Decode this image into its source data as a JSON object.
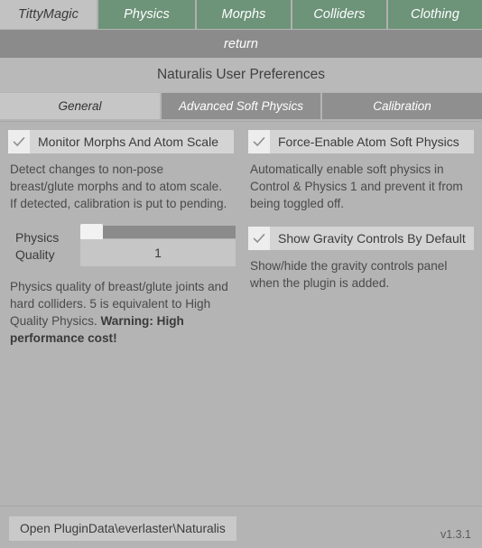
{
  "window": {
    "background_color": "#b4b4b4",
    "accent_green": "#6d9379"
  },
  "plugin_tabs": {
    "items": [
      {
        "label": "TittyMagic",
        "active": true
      },
      {
        "label": "Physics",
        "active": false
      },
      {
        "label": "Morphs",
        "active": false
      },
      {
        "label": "Colliders",
        "active": false
      },
      {
        "label": "Clothing",
        "active": false
      }
    ]
  },
  "return_bar": {
    "label": "return"
  },
  "header": {
    "title": "Naturalis User Preferences"
  },
  "sub_tabs": {
    "items": [
      {
        "label": "General",
        "active": true
      },
      {
        "label": "Advanced Soft Physics",
        "active": false
      },
      {
        "label": "Calibration",
        "active": false
      }
    ]
  },
  "left_column": {
    "monitor_morphs": {
      "label": "Monitor Morphs And Atom Scale",
      "checked": true,
      "check_icon": "check-icon",
      "description": "Detect changes to non-pose\nbreast/glute morphs and to atom scale.\nIf detected, calibration is put to pending."
    },
    "physics_quality": {
      "label": "Physics\nQuality",
      "value": "1",
      "handle_position_percent": 0,
      "description_part1": "Physics quality of breast/glute joints and hard colliders. 5 is equivalent to High Quality Physics. ",
      "description_warning": "Warning: High performance cost!"
    }
  },
  "right_column": {
    "force_enable_soft_physics": {
      "label": "Force-Enable Atom Soft Physics",
      "checked": true,
      "check_icon": "check-icon",
      "description": "Automatically enable soft physics in\nControl & Physics 1 and prevent it from\nbeing toggled off."
    },
    "show_gravity_controls": {
      "label": "Show Gravity Controls By Default",
      "checked": true,
      "check_icon": "check-icon",
      "description": "Show/hide the gravity controls panel\nwhen the plugin is added."
    }
  },
  "footer": {
    "open_folder_button": "Open PluginData\\everlaster\\Naturalis",
    "version": "v1.3.1"
  }
}
